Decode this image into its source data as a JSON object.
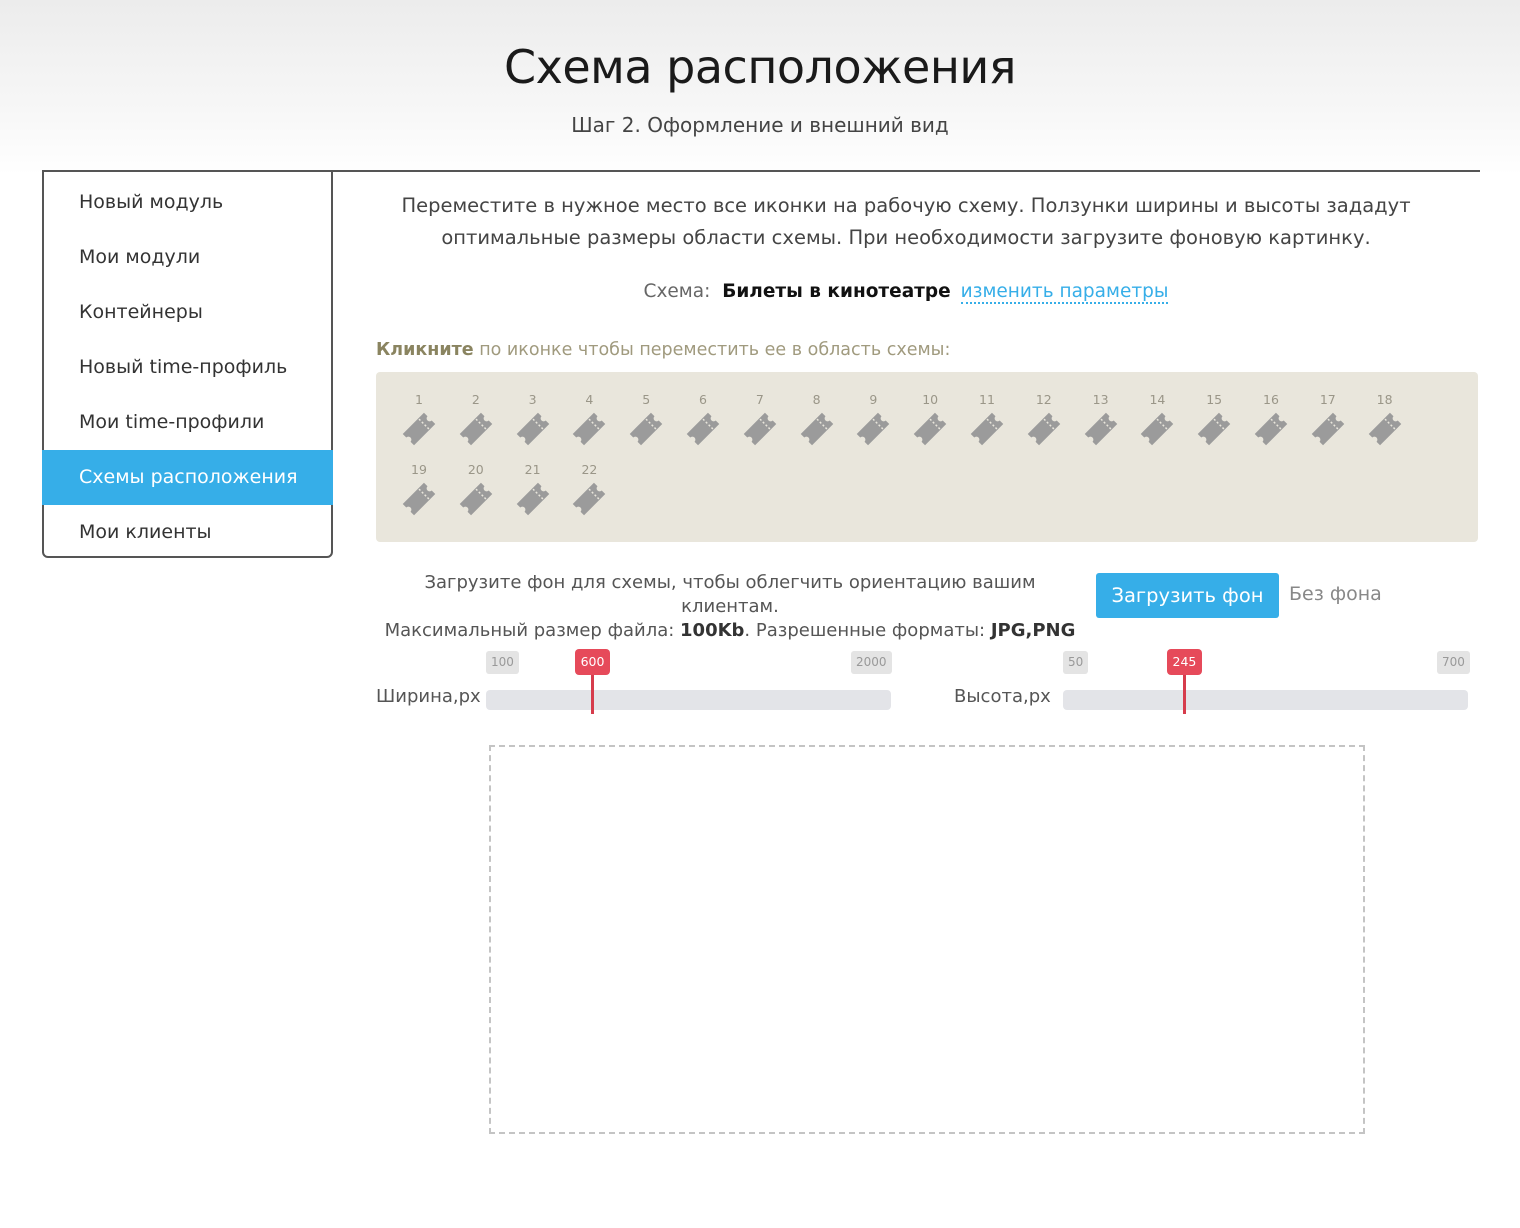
{
  "header": {
    "title": "Схема расположения",
    "subtitle": "Шаг 2. Оформление и внешний вид"
  },
  "sidebar": {
    "items": [
      {
        "label": "Новый модуль",
        "active": false
      },
      {
        "label": "Мои модули",
        "active": false
      },
      {
        "label": "Контейнеры",
        "active": false
      },
      {
        "label": "Новый time-профиль",
        "active": false
      },
      {
        "label": "Мои time-профили",
        "active": false
      },
      {
        "label": "Схемы расположения",
        "active": true
      },
      {
        "label": "Мои клиенты",
        "active": false
      }
    ]
  },
  "main": {
    "intro": "Переместите в нужное место все иконки на рабочую схему. Ползунки ширины и высоты зададут оптимальные размеры области схемы. При необходимости загрузите фоновую картинку.",
    "scheme_label": "Схема:",
    "scheme_name": "Билеты в кинотеатре",
    "scheme_edit_link": "изменить параметры",
    "hint_strong": "Кликните",
    "hint_rest": "по иконке чтобы переместить ее в область схемы:",
    "tickets": [
      "1",
      "2",
      "3",
      "4",
      "5",
      "6",
      "7",
      "8",
      "9",
      "10",
      "11",
      "12",
      "13",
      "14",
      "15",
      "16",
      "17",
      "18",
      "19",
      "20",
      "21",
      "22"
    ],
    "ticket_icon": "ticket-icon",
    "upload_line1": "Загрузите фон для схемы, чтобы облегчить ориентацию вашим клиентам.",
    "upload_line2_pre": "Максимальный размер файла: ",
    "upload_size": "100Kb",
    "upload_line2_mid": ". Разрешенные форматы: ",
    "upload_formats": "JPG,PNG",
    "upload_button": "Загрузить фон",
    "no_background": "Без фона"
  },
  "sliders": {
    "width": {
      "label": "Ширина,px",
      "min": 100,
      "max": 2000,
      "value": 600,
      "min_label": "100",
      "max_label": "2000",
      "value_label": "600"
    },
    "height": {
      "label": "Высота,px",
      "min": 50,
      "max": 700,
      "value": 245,
      "min_label": "50",
      "max_label": "700",
      "value_label": "245"
    }
  },
  "colors": {
    "accent": "#36aee8",
    "slider_marker": "#e64a5a",
    "tray_background": "#e9e6dc",
    "ticket": "#9b9b9b"
  }
}
